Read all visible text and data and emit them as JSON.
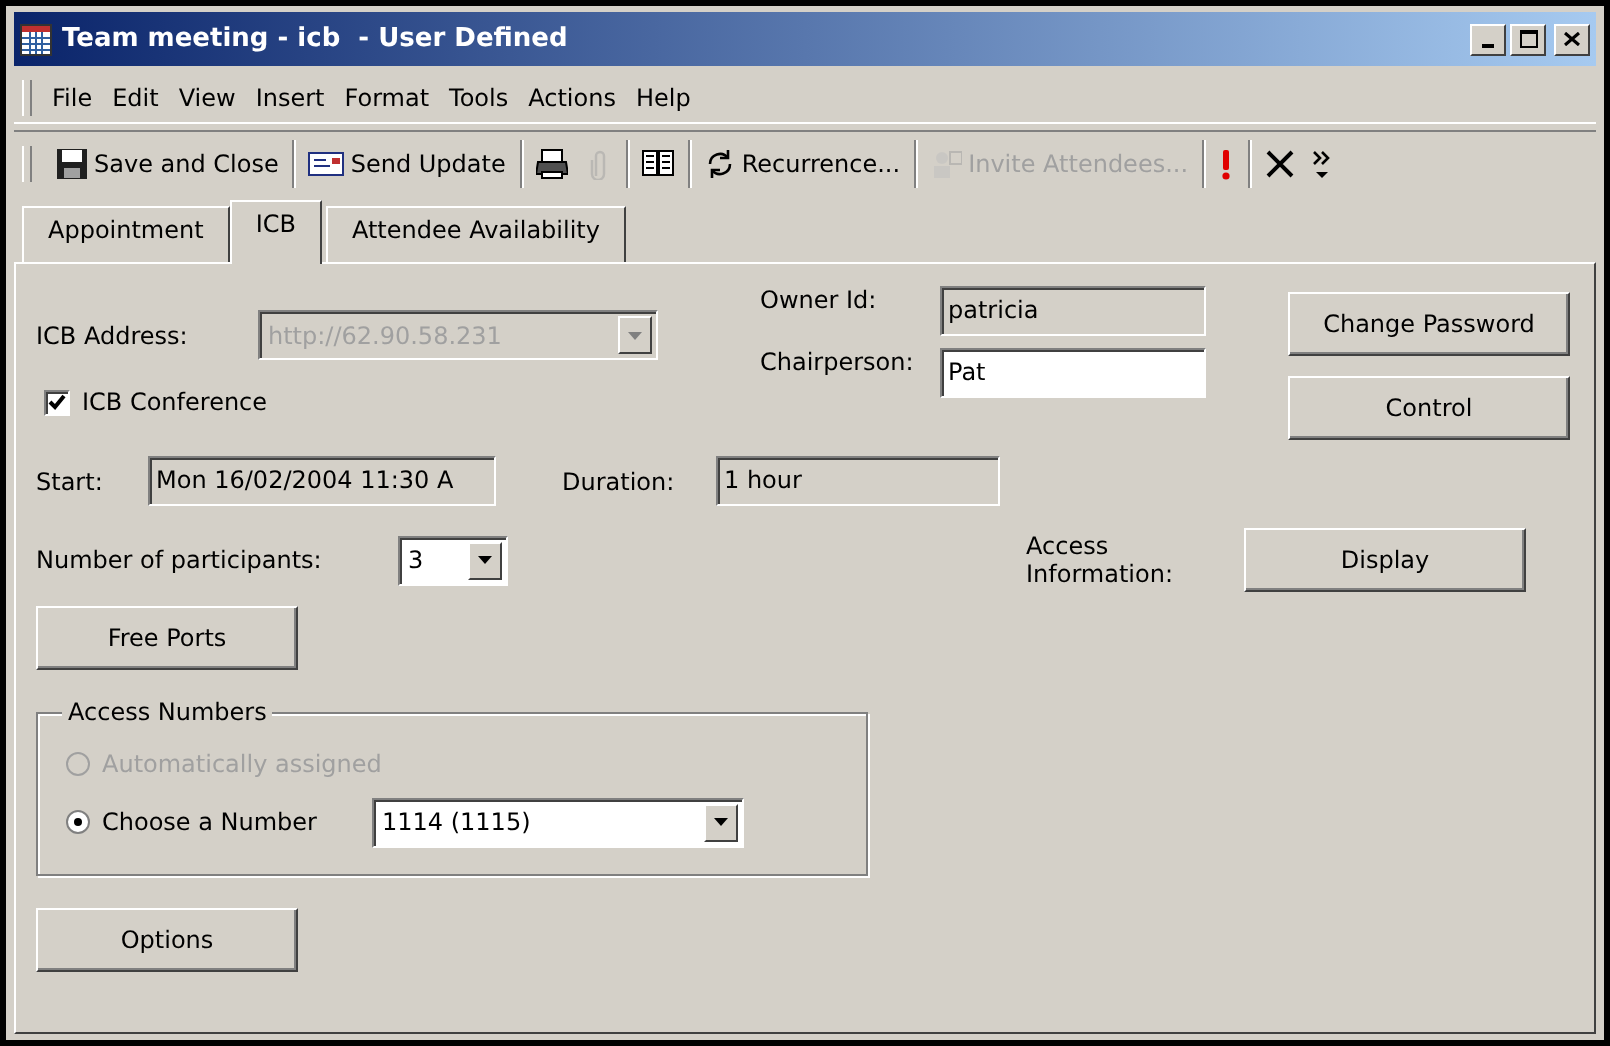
{
  "window": {
    "title": "Team meeting - icb  - User Defined"
  },
  "menu": [
    {
      "label": "File"
    },
    {
      "label": "Edit"
    },
    {
      "label": "View"
    },
    {
      "label": "Insert"
    },
    {
      "label": "Format"
    },
    {
      "label": "Tools"
    },
    {
      "label": "Actions"
    },
    {
      "label": "Help"
    }
  ],
  "toolbar": [
    {
      "items": [
        {
          "kind": "save",
          "label": "Save and Close",
          "disabled": false
        }
      ]
    },
    {
      "items": [
        {
          "kind": "send",
          "label": "Send Update",
          "disabled": false
        }
      ]
    },
    {
      "items": [
        {
          "kind": "print",
          "disabled": false
        },
        {
          "kind": "attach",
          "disabled": true
        }
      ]
    },
    {
      "items": [
        {
          "kind": "book",
          "disabled": false
        }
      ]
    },
    {
      "items": [
        {
          "kind": "recurrence",
          "label": "Recurrence...",
          "disabled": false
        }
      ]
    },
    {
      "items": [
        {
          "kind": "invite",
          "label": "Invite Attendees...",
          "disabled": true
        }
      ]
    },
    {
      "items": [
        {
          "kind": "importance",
          "disabled": false
        }
      ]
    },
    {
      "items": [
        {
          "kind": "delete",
          "disabled": false
        },
        {
          "kind": "more",
          "disabled": false
        }
      ]
    }
  ],
  "tabs": [
    {
      "label": "Appointment",
      "selected": false
    },
    {
      "label": "ICB",
      "selected": true
    },
    {
      "label": "Attendee Availability",
      "selected": false
    }
  ],
  "icb": {
    "address": {
      "label": "ICB Address:",
      "value": "http://62.90.58.231",
      "disabled": true
    },
    "conference": {
      "label": "ICB Conference",
      "checked": true
    },
    "owner_id": {
      "label": "Owner Id:",
      "value": "patricia",
      "readonly": true
    },
    "chairperson": {
      "label": "Chairperson:",
      "value": "Pat",
      "readonly": false
    },
    "change_password": "Change Password",
    "control": "Control",
    "start": {
      "label": "Start:",
      "value": "Mon 16/02/2004 11:30 A",
      "readonly": true
    },
    "duration": {
      "label": "Duration:",
      "value": "1 hour",
      "readonly": true
    },
    "participants": {
      "label": "Number of participants:",
      "value": "3",
      "disabled": false
    },
    "access_information": {
      "label": "Access Information:",
      "button": "Display"
    },
    "free_ports": "Free Ports",
    "access_numbers": {
      "legend": "Access Numbers",
      "options": [
        {
          "label": "Automatically assigned",
          "selected": false,
          "disabled": true
        },
        {
          "label": "Choose a Number",
          "selected": true,
          "disabled": false
        }
      ],
      "number": {
        "value": "1114 (1115)",
        "disabled": false
      }
    },
    "options": "Options"
  }
}
